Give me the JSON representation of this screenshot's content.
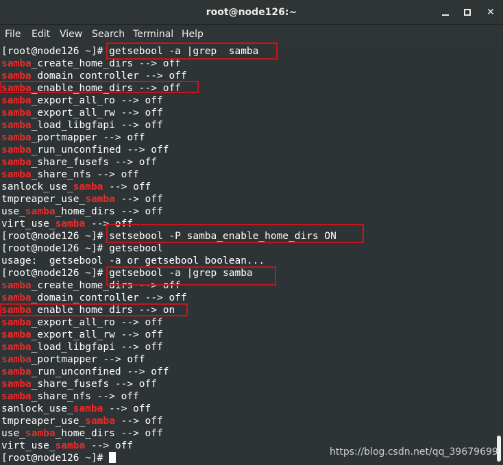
{
  "window": {
    "title": "root@node126:~"
  },
  "menu": [
    "File",
    "Edit",
    "View",
    "Search",
    "Terminal",
    "Help"
  ],
  "terminal": {
    "prompt": "[root@node126 ~]# ",
    "lines": [
      [
        {
          "t": "[root@node126 ~]# getsebool -a |grep  samba"
        }
      ],
      [
        {
          "t": "samba",
          "h": true
        },
        {
          "t": "_create_home_dirs --> off"
        }
      ],
      [
        {
          "t": "samba",
          "h": true
        },
        {
          "t": "_domain_controller --> off"
        }
      ],
      [
        {
          "t": "samba",
          "h": true
        },
        {
          "t": "_enable_home_dirs --> off"
        }
      ],
      [
        {
          "t": "samba",
          "h": true
        },
        {
          "t": "_export_all_ro --> off"
        }
      ],
      [
        {
          "t": "samba",
          "h": true
        },
        {
          "t": "_export_all_rw --> off"
        }
      ],
      [
        {
          "t": "samba",
          "h": true
        },
        {
          "t": "_load_libgfapi --> off"
        }
      ],
      [
        {
          "t": "samba",
          "h": true
        },
        {
          "t": "_portmapper --> off"
        }
      ],
      [
        {
          "t": "samba",
          "h": true
        },
        {
          "t": "_run_unconfined --> off"
        }
      ],
      [
        {
          "t": "samba",
          "h": true
        },
        {
          "t": "_share_fusefs --> off"
        }
      ],
      [
        {
          "t": "samba",
          "h": true
        },
        {
          "t": "_share_nfs --> off"
        }
      ],
      [
        {
          "t": "sanlock_use_"
        },
        {
          "t": "samba",
          "h": true
        },
        {
          "t": " --> off"
        }
      ],
      [
        {
          "t": "tmpreaper_use_"
        },
        {
          "t": "samba",
          "h": true
        },
        {
          "t": " --> off"
        }
      ],
      [
        {
          "t": "use_"
        },
        {
          "t": "samba",
          "h": true
        },
        {
          "t": "_home_dirs --> off"
        }
      ],
      [
        {
          "t": "virt_use_"
        },
        {
          "t": "samba",
          "h": true
        },
        {
          "t": " --> off"
        }
      ],
      [
        {
          "t": "[root@node126 ~]# setsebool -P samba_enable_home_dirs ON"
        }
      ],
      [
        {
          "t": "[root@node126 ~]# getsebool"
        }
      ],
      [
        {
          "t": "usage:  getsebool -a or getsebool boolean..."
        }
      ],
      [
        {
          "t": "[root@node126 ~]# getsebool -a |grep samba"
        }
      ],
      [
        {
          "t": "samba",
          "h": true
        },
        {
          "t": "_create_home_dirs --> off"
        }
      ],
      [
        {
          "t": "samba",
          "h": true
        },
        {
          "t": "_domain_controller --> off"
        }
      ],
      [
        {
          "t": "samba",
          "h": true
        },
        {
          "t": "_enable_home_dirs --> on"
        }
      ],
      [
        {
          "t": "samba",
          "h": true
        },
        {
          "t": "_export_all_ro --> off"
        }
      ],
      [
        {
          "t": "samba",
          "h": true
        },
        {
          "t": "_export_all_rw --> off"
        }
      ],
      [
        {
          "t": "samba",
          "h": true
        },
        {
          "t": "_load_libgfapi --> off"
        }
      ],
      [
        {
          "t": "samba",
          "h": true
        },
        {
          "t": "_portmapper --> off"
        }
      ],
      [
        {
          "t": "samba",
          "h": true
        },
        {
          "t": "_run_unconfined --> off"
        }
      ],
      [
        {
          "t": "samba",
          "h": true
        },
        {
          "t": "_share_fusefs --> off"
        }
      ],
      [
        {
          "t": "samba",
          "h": true
        },
        {
          "t": "_share_nfs --> off"
        }
      ],
      [
        {
          "t": "sanlock_use_"
        },
        {
          "t": "samba",
          "h": true
        },
        {
          "t": " --> off"
        }
      ],
      [
        {
          "t": "tmpreaper_use_"
        },
        {
          "t": "samba",
          "h": true
        },
        {
          "t": " --> off"
        }
      ],
      [
        {
          "t": "use_"
        },
        {
          "t": "samba",
          "h": true
        },
        {
          "t": "_home_dirs --> off"
        }
      ],
      [
        {
          "t": "virt_use_"
        },
        {
          "t": "samba",
          "h": true
        },
        {
          "t": " --> off"
        }
      ]
    ]
  },
  "watermark": "https://blog.csdn.net/qq_39679699",
  "colors": {
    "background": "#2e3436",
    "highlight": "#ef2929",
    "annotation": "#c4161c"
  },
  "icons": {
    "minimize": "minimize-icon",
    "maximize": "maximize-icon",
    "close": "close-icon"
  }
}
